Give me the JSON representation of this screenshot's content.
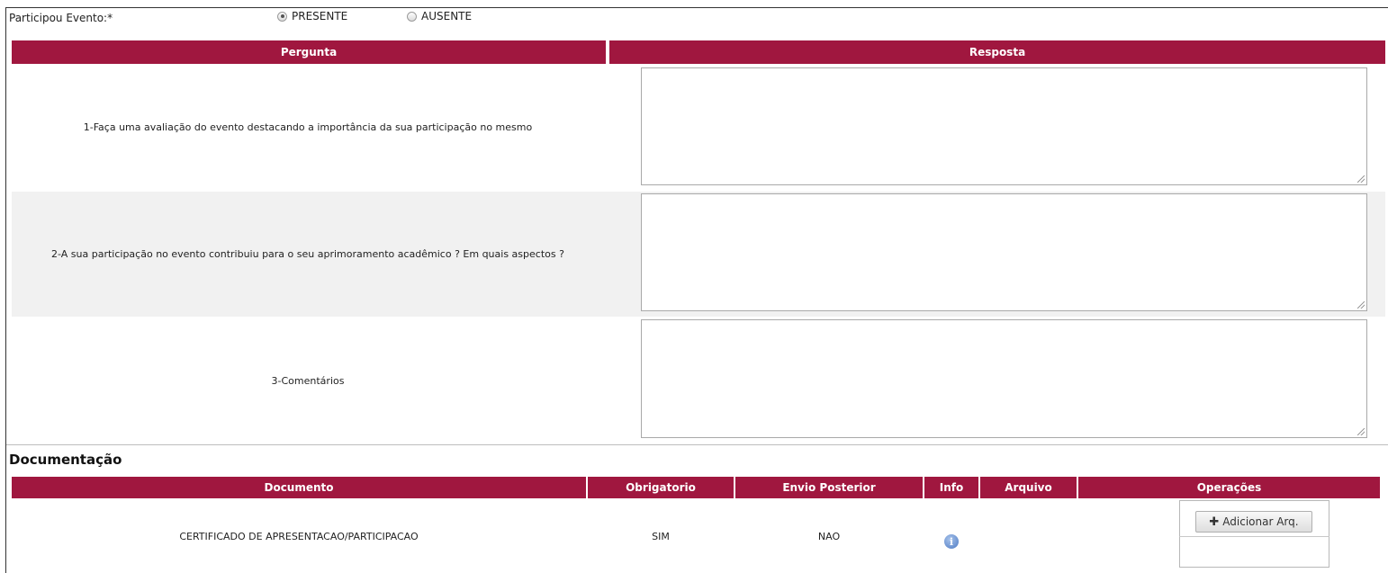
{
  "attendance": {
    "label": "Participou Evento:*",
    "options": [
      {
        "label": "PRESENTE",
        "checked": true
      },
      {
        "label": "AUSENTE",
        "checked": false
      }
    ]
  },
  "qa_table": {
    "headers": {
      "question": "Pergunta",
      "answer": "Resposta"
    },
    "rows": [
      {
        "question": "1-Faça uma avaliação do evento destacando a importância da sua participação no mesmo",
        "answer": ""
      },
      {
        "question": "2-A sua participação no evento contribuiu para o seu aprimoramento acadêmico ? Em quais aspectos ?",
        "answer": ""
      },
      {
        "question": "3-Comentários",
        "answer": ""
      }
    ]
  },
  "documentation": {
    "title": "Documentação",
    "headers": {
      "documento": "Documento",
      "obrigatorio": "Obrigatorio",
      "envio_posterior": "Envio Posterior",
      "info": "Info",
      "arquivo": "Arquivo",
      "operacoes": "Operações"
    },
    "rows": [
      {
        "documento": "CERTIFICADO DE APRESENTACAO/PARTICIPACAO",
        "obrigatorio": "SIM",
        "envio_posterior": "NAO",
        "info_icon": "info-icon",
        "arquivo": "",
        "operacao_label": "Adicionar Arq."
      }
    ]
  },
  "colors": {
    "header_bg": "#a0173f",
    "alt_row_bg": "#f1f1f1"
  }
}
